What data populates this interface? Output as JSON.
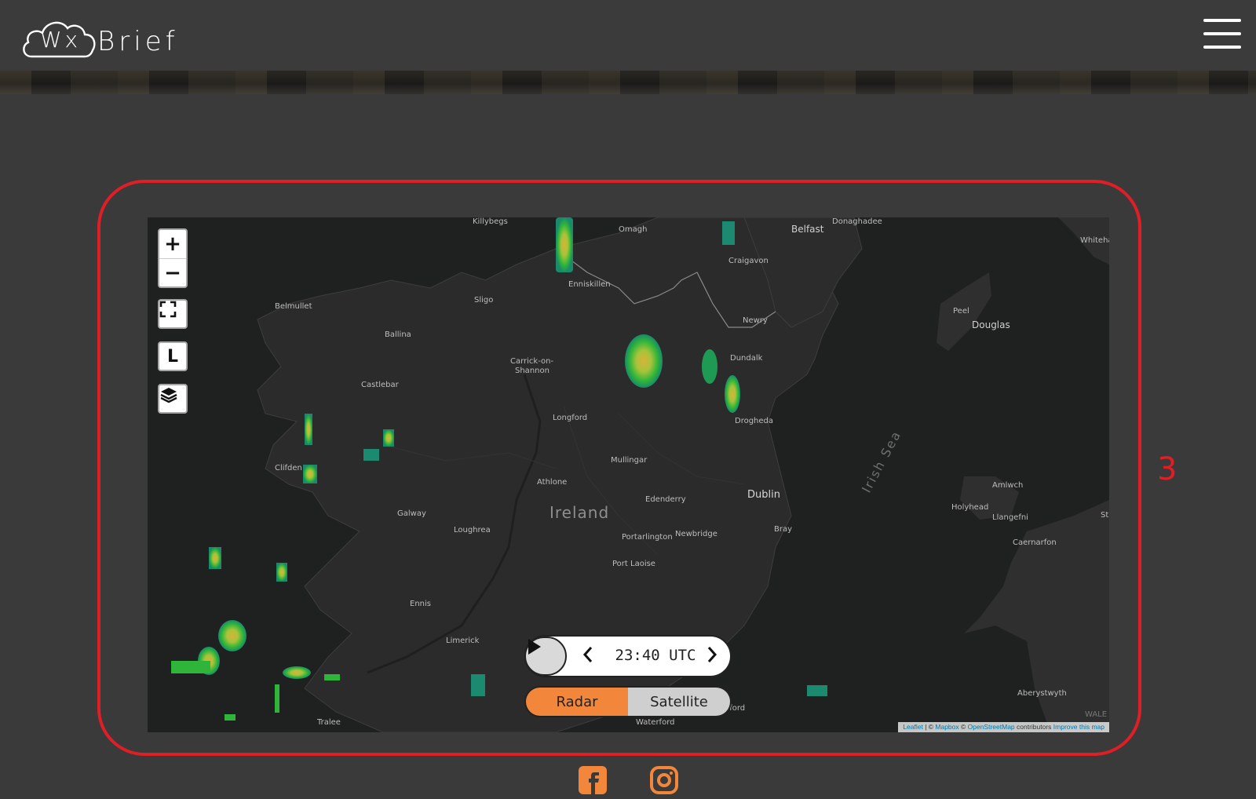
{
  "header": {
    "logo_wx": "Wx",
    "logo_brief": "Brief",
    "menu_icon": "hamburger-icon"
  },
  "annotation": {
    "number": "3",
    "color": "#e01e26"
  },
  "map": {
    "controls": {
      "zoom_in": "+",
      "zoom_out": "−",
      "fullscreen_icon": "fullscreen-icon",
      "locate_label": "L",
      "layers_icon": "layers-icon"
    },
    "player": {
      "play_icon": "play-icon",
      "prev_icon": "chevron-left-icon",
      "next_icon": "chevron-right-icon",
      "time": "23:40 UTC"
    },
    "layer_toggle": {
      "radar": "Radar",
      "satellite": "Satellite",
      "active": "Radar",
      "active_color": "#f2873b"
    },
    "attribution": {
      "leaflet": "Leaflet",
      "sep1": " | © ",
      "mapbox": "Mapbox",
      "sep2": " © ",
      "osm": "OpenStreetMap",
      "contributors": " contributors ",
      "improve": "Improve this map"
    },
    "country_label": "Ireland",
    "sea_label": "Irish Sea",
    "places": [
      "Killybegs",
      "Omagh",
      "Belfast",
      "Donaghadee",
      "Whiteha",
      "Craigavon",
      "Enniskillen",
      "Belmullet",
      "Sligo",
      "Newry",
      "Peel",
      "Douglas",
      "Ballina",
      "Dundalk",
      "Carrick-on-",
      "Shannon",
      "Castlebar",
      "Drogheda",
      "Longford",
      "Mullingar",
      "Clifden",
      "Athlone",
      "Dublin",
      "Amlwch",
      "Edenderry",
      "Holyhead",
      "Llangefni",
      "St",
      "Galway",
      "Loughrea",
      "Bray",
      "Portarlington",
      "Newbridge",
      "Caernarfon",
      "Port Laoise",
      "Ennis",
      "Limerick",
      "Aberystwyth",
      "Tralee",
      "Waterford",
      "Wexford",
      "WALE"
    ]
  },
  "footer": {
    "icons": [
      "facebook-icon",
      "instagram-icon"
    ],
    "icon_color": "#f2873b"
  }
}
